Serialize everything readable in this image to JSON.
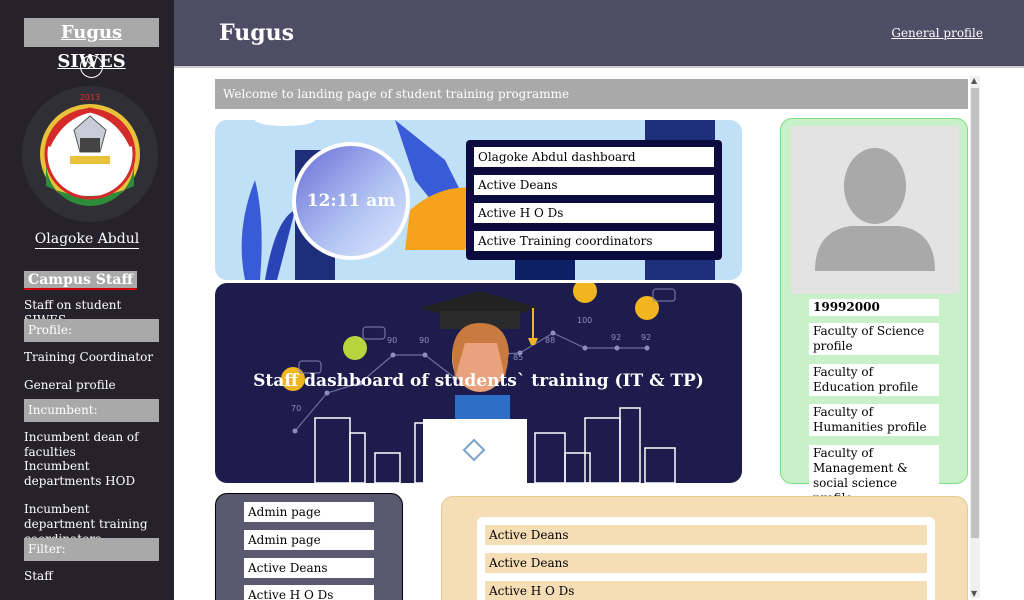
{
  "sidebar": {
    "brand": "Fugus SIWES",
    "close_symbol": "×",
    "logo_icon": "university-crest-icon",
    "user_name": "Olagoke Abdul",
    "section_title": "Campus Staff",
    "items": [
      "Staff on student SIWES",
      "Profile:",
      "Training Coordinator",
      "General profile",
      "Incumbent:",
      "Incumbent dean of faculties",
      "Incumbent departments HOD",
      "Incumbent department training coordinators",
      "Filter:",
      "Staff"
    ]
  },
  "header": {
    "title": "Fugus",
    "profile_link": "General profile"
  },
  "main": {
    "welcome": "Welcome to landing page of student training programme",
    "clock": "12:11 am",
    "dashboard_links": [
      "Olagoke Abdul dashboard",
      "Active Deans",
      "Active H O Ds",
      "Active Training coordinators"
    ],
    "banner_caption": "Staff dashboard of students` training (IT & TP)",
    "banner_graph_labels": [
      "70",
      "90",
      "90",
      "85",
      "88",
      "100",
      "92",
      "92"
    ]
  },
  "profile": {
    "avatar_icon": "user-silhouette-icon",
    "id": "19992000",
    "items": [
      "Faculty of Science profile",
      "Faculty of Education profile",
      "Faculty of Humanities profile",
      "Faculty of Management & social science profile"
    ]
  },
  "admin_panel": {
    "items": [
      "Admin page",
      "Admin page",
      "Active Deans",
      "Active H O Ds"
    ]
  },
  "active_panel": {
    "items": [
      "Active Deans",
      "Active Deans",
      "Active H O Ds"
    ]
  },
  "colors": {
    "sidebar_bg": "#25222b",
    "header_bg": "#4f4d66",
    "profile_bg": "#c9f1c9",
    "active_panel_bg": "#f5ddb6",
    "banner_dark": "#1d1c4d"
  }
}
